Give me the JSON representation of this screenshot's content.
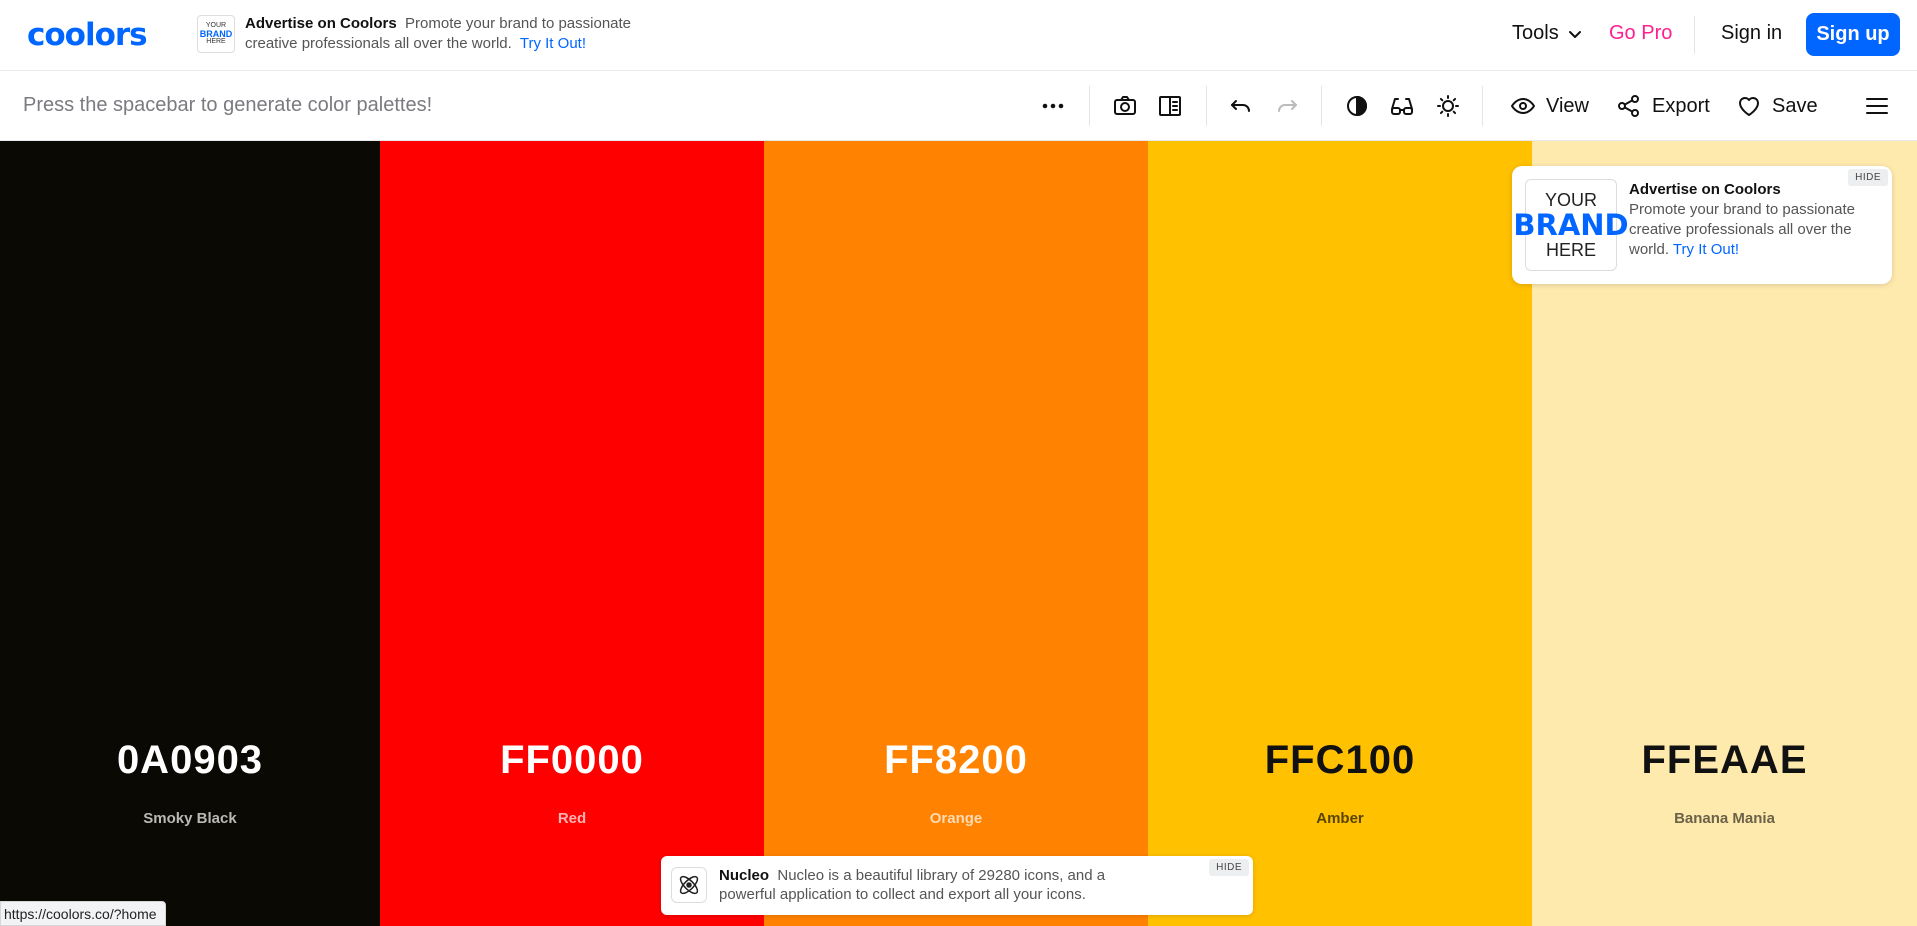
{
  "header": {
    "logo": "coolors",
    "ad": {
      "thumb": [
        "YOUR",
        "BRAND",
        "HERE"
      ],
      "title": "Advertise on Coolors",
      "text_line1": "Promote your brand to passionate",
      "text_line2": "creative professionals all over the world.",
      "link": "Try It Out!"
    },
    "tools_label": "Tools",
    "gopro_label": "Go Pro",
    "signin_label": "Sign in",
    "signup_label": "Sign up"
  },
  "toolbar": {
    "hint": "Press the spacebar to generate color palettes!",
    "view_label": "View",
    "export_label": "Export",
    "save_label": "Save"
  },
  "palette": [
    {
      "hex": "0A0903",
      "name": "Smoky Black",
      "color": "#0a0903",
      "text_color": "#ffffff",
      "name_color": "#b9b9b7"
    },
    {
      "hex": "FF0000",
      "name": "Red",
      "color": "#ff0000",
      "text_color": "#ffffff",
      "name_color": "#ffb3b3"
    },
    {
      "hex": "FF8200",
      "name": "Orange",
      "color": "#ff8200",
      "text_color": "#ffffff",
      "name_color": "#ffdab3"
    },
    {
      "hex": "FFC100",
      "name": "Amber",
      "color": "#ffc100",
      "text_color": "#111111",
      "name_color": "#5a4500"
    },
    {
      "hex": "FFEAAE",
      "name": "Banana Mania",
      "color": "#ffeaae",
      "text_color": "#111111",
      "name_color": "#6b6248"
    }
  ],
  "side_ad": {
    "thumb": [
      "YOUR",
      "BRAND",
      "HERE"
    ],
    "title": "Advertise on Coolors",
    "text": "Promote your brand to passionate creative professionals all over the world.",
    "link": "Try It Out!",
    "hide_label": "HIDE"
  },
  "bottom_ad": {
    "title": "Nucleo",
    "text": "Nucleo is a beautiful library of 29280 icons, and a powerful application to collect and export all your icons.",
    "hide_label": "HIDE"
  },
  "status_url": "https://coolors.co/?home"
}
